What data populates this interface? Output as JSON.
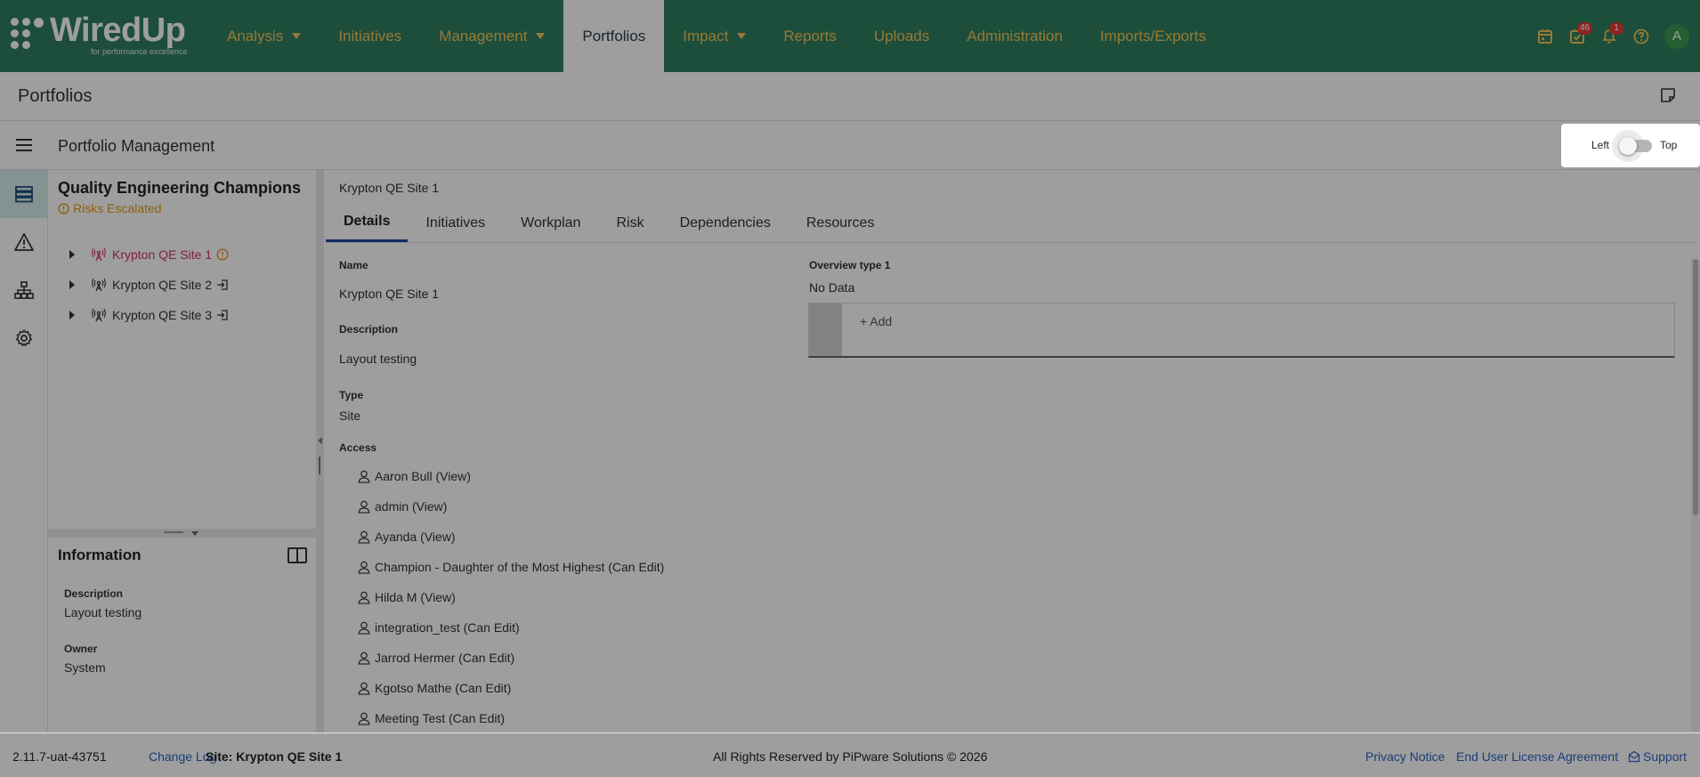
{
  "app": {
    "logo_text": "WiredUp",
    "logo_tagline": "for performance excellence"
  },
  "nav": {
    "items": [
      {
        "label": "Analysis",
        "has_dropdown": true,
        "active": false
      },
      {
        "label": "Initiatives",
        "has_dropdown": false,
        "active": false
      },
      {
        "label": "Management",
        "has_dropdown": true,
        "active": false
      },
      {
        "label": "Portfolios",
        "has_dropdown": false,
        "active": true
      },
      {
        "label": "Impact",
        "has_dropdown": true,
        "active": false
      },
      {
        "label": "Reports",
        "has_dropdown": false,
        "active": false
      },
      {
        "label": "Uploads",
        "has_dropdown": false,
        "active": false
      },
      {
        "label": "Administration",
        "has_dropdown": false,
        "active": false
      },
      {
        "label": "Imports/Exports",
        "has_dropdown": false,
        "active": false
      }
    ],
    "tasks_badge": "46",
    "notifications_badge": "1",
    "avatar_initial": "A"
  },
  "page": {
    "title": "Portfolios",
    "section_title": "Portfolio Management"
  },
  "layout_toggle": {
    "left_label": "Left",
    "right_label": "Top",
    "state": "Left"
  },
  "tree": {
    "root_title": "Quality Engineering Champions",
    "root_status": "Risks Escalated",
    "items": [
      {
        "label": "Krypton QE Site 1",
        "selected": true,
        "marker": "warning"
      },
      {
        "label": "Krypton QE Site 2",
        "selected": false,
        "marker": "login"
      },
      {
        "label": "Krypton QE Site 3",
        "selected": false,
        "marker": "login"
      }
    ]
  },
  "info": {
    "title": "Information",
    "description_label": "Description",
    "description_value": "Layout testing",
    "owner_label": "Owner",
    "owner_value": "System"
  },
  "detail": {
    "breadcrumb": "Krypton QE Site 1",
    "tabs": [
      "Details",
      "Initiatives",
      "Workplan",
      "Risk",
      "Dependencies",
      "Resources"
    ],
    "active_tab": "Details",
    "name_label": "Name",
    "name_value": "Krypton QE Site 1",
    "description_label": "Description",
    "description_value": "Layout testing",
    "type_label": "Type",
    "type_value": "Site",
    "access_label": "Access",
    "access": [
      "Aaron Bull (View)",
      "admin (View)",
      "Ayanda (View)",
      "Champion - Daughter of the Most Highest (Can Edit)",
      "Hilda M (View)",
      "integration_test (Can Edit)",
      "Jarrod Hermer (Can Edit)",
      "Kgotso Mathe (Can Edit)",
      "Meeting Test (Can Edit)"
    ],
    "overview_label": "Overview type 1",
    "overview_value": "No Data",
    "overview_add": "+ Add"
  },
  "footer": {
    "version": "2.11.7-uat-43751",
    "change_log": "Change Log",
    "site": "Site: Krypton QE Site 1",
    "copyright": "All Rights Reserved by PiPware Solutions © 2026",
    "privacy": "Privacy Notice",
    "eula": "End User License Agreement",
    "support": "Support"
  },
  "colors": {
    "brand_green": "#2f7f5f",
    "nav_text": "#f2c55a",
    "selected_node": "#d4326c",
    "warning": "#e69a19",
    "link": "#2a64c7",
    "active_tab_underline": "#1f4aa8"
  }
}
